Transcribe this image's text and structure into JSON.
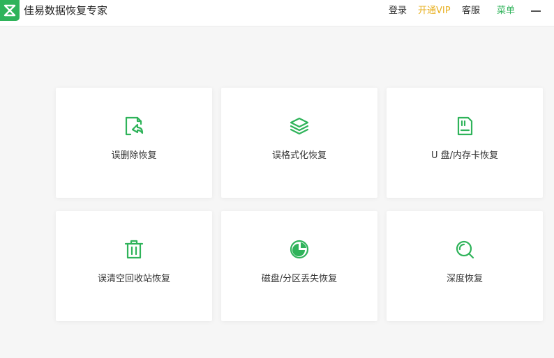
{
  "app": {
    "title": "佳易数据恢复专家"
  },
  "header": {
    "login": "登录",
    "vip": "开通VIP",
    "service": "客服",
    "menu": "菜单"
  },
  "colors": {
    "accent": "#2fb35a",
    "vip": "#e8b021"
  },
  "cards": [
    {
      "label": "误删除恢复",
      "icon": "file-restore-icon"
    },
    {
      "label": "误格式化恢复",
      "icon": "layers-icon"
    },
    {
      "label": "U 盘/内存卡恢复",
      "icon": "sd-card-icon"
    },
    {
      "label": "误清空回收站恢复",
      "icon": "trash-icon"
    },
    {
      "label": "磁盘/分区丢失恢复",
      "icon": "pie-chart-icon"
    },
    {
      "label": "深度恢复",
      "icon": "search-icon"
    }
  ]
}
